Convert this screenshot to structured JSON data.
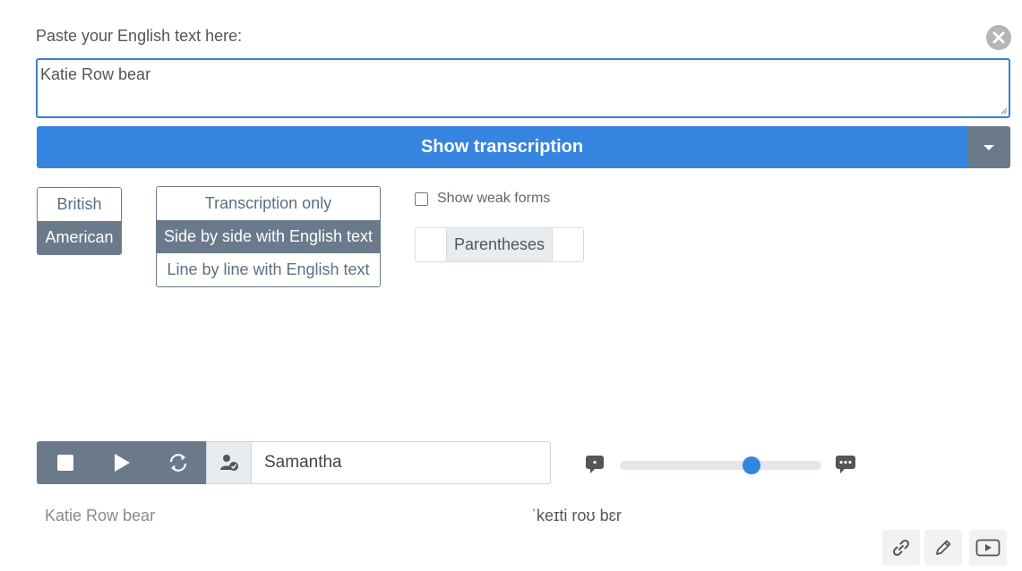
{
  "prompt": {
    "label": "Paste your English text here:"
  },
  "input": {
    "value": "Katie Row bear"
  },
  "show_button": {
    "label": "Show transcription"
  },
  "accent": {
    "options": [
      "British",
      "American"
    ],
    "selected": "American"
  },
  "layout": {
    "options": [
      "Transcription only",
      "Side by side with English text",
      "Line by line with English text"
    ],
    "selected": "Side by side with English text"
  },
  "weak_forms": {
    "label": "Show weak forms",
    "checked": false
  },
  "parentheses": {
    "label": "Parentheses"
  },
  "player": {
    "voice": "Samantha",
    "speed_fraction": 0.67
  },
  "output": {
    "english": "Katie Row bear",
    "ipa": "ˈkeɪti roʊ bɛr"
  },
  "colors": {
    "primary": "#3584e0",
    "secondary": "#6b7a8b"
  },
  "icons": [
    "close-icon",
    "caret-down-icon",
    "stop-icon",
    "play-icon",
    "repeat-icon",
    "voice-user-icon",
    "speech-slow-icon",
    "speech-fast-icon",
    "link-icon",
    "pencil-icon",
    "video-icon"
  ]
}
